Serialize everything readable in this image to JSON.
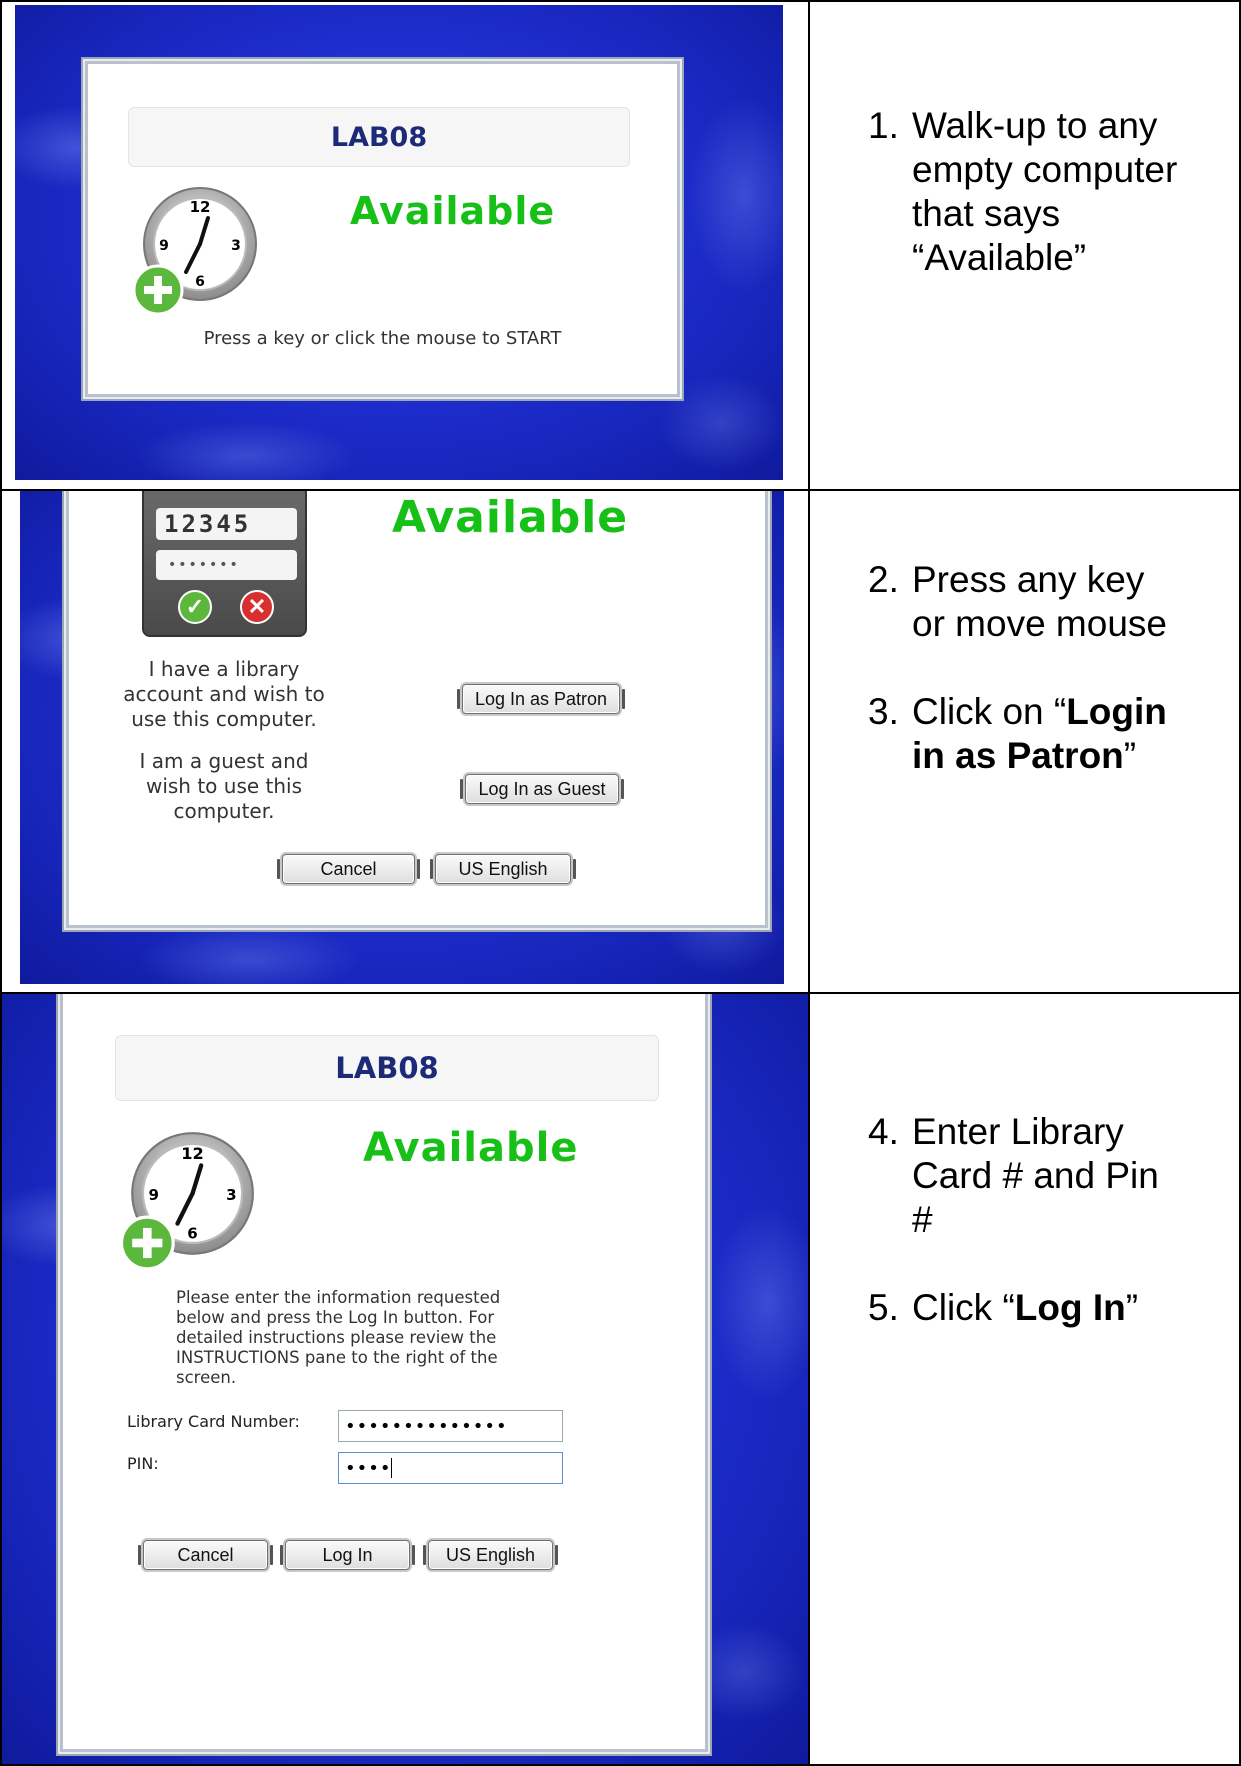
{
  "section1": {
    "station_name": "LAB08",
    "status": "Available",
    "prompt": "Press a key or click the mouse to START",
    "clock_numerals": [
      "12",
      "3",
      "6",
      "9"
    ],
    "instructions": [
      {
        "num": "1.",
        "lines": [
          "Walk-up to any",
          "empty computer",
          "that says",
          "“Available”"
        ]
      }
    ]
  },
  "section2": {
    "keypad_number": "12345",
    "keypad_masked": "•••••••",
    "status": "Available",
    "patron_text": [
      "I have a library",
      "account and wish to",
      "use this computer."
    ],
    "guest_text": [
      "I am a guest and",
      "wish to use this",
      "computer."
    ],
    "patron_button": "Log In as Patron",
    "guest_button": "Log In as Guest",
    "cancel_button": "Cancel",
    "language_button": "US English",
    "instructions": [
      {
        "num": "2.",
        "lines": [
          "Press any key",
          "or move mouse"
        ]
      },
      {
        "num": "3.",
        "pre": "Click on “",
        "bold1": "Login",
        "bold2": "in as Patron",
        "post": "”"
      }
    ]
  },
  "section3": {
    "station_name": "LAB08",
    "status": "Available",
    "clock_numerals": [
      "12",
      "3",
      "6",
      "9"
    ],
    "info_lines": [
      "Please enter the information requested",
      "below and press the Log In button. For",
      "detailed instructions please review the",
      "INSTRUCTIONS pane to the right of the",
      "screen."
    ],
    "card_label": "Library Card Number:",
    "card_value": "••••••••••••••",
    "pin_label": "PIN:",
    "pin_value": "••••",
    "cancel_button": "Cancel",
    "login_button": "Log In",
    "language_button": "US English",
    "instructions": [
      {
        "num": "4.",
        "lines": [
          "Enter Library",
          "Card # and Pin",
          "#"
        ]
      },
      {
        "num": "5.",
        "pre": "Click “",
        "bold1": "Log In",
        "post": "”"
      }
    ]
  },
  "colors": {
    "available_green": "#17c017",
    "title_navy": "#1c2a78",
    "background_blue": "#1f2fd0"
  }
}
